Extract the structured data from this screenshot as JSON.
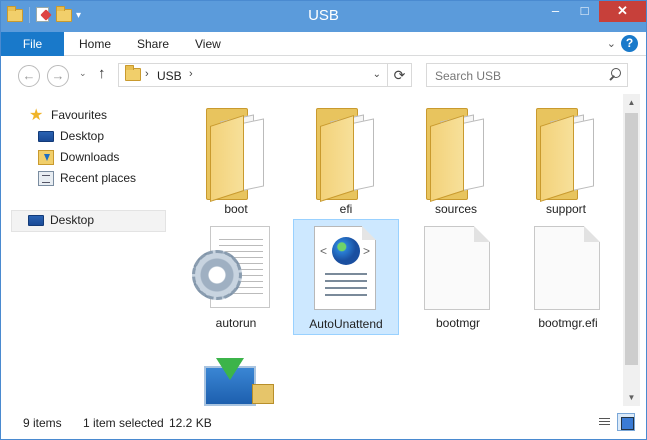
{
  "window": {
    "title": "USB"
  },
  "controls": {
    "minimize": "–",
    "maximize": "□",
    "close": "✕"
  },
  "ribbon": {
    "file_label": "File",
    "tabs": [
      {
        "label": "Home"
      },
      {
        "label": "Share"
      },
      {
        "label": "View"
      }
    ],
    "collapse_glyph": "⌄",
    "help_glyph": "?"
  },
  "nav": {
    "back_glyph": "←",
    "forward_glyph": "→",
    "recent_glyph": "⌄",
    "up_glyph": "↑",
    "address": {
      "segments": [
        "USB"
      ],
      "separator": "›",
      "dropdown_glyph": "⌄",
      "refresh_glyph": "⟳"
    },
    "search": {
      "placeholder": "Search USB"
    }
  },
  "navpane": {
    "favourites_label": "Favourites",
    "favourites": [
      {
        "label": "Desktop",
        "icon": "desktop-icon"
      },
      {
        "label": "Downloads",
        "icon": "downloads-icon"
      },
      {
        "label": "Recent places",
        "icon": "recent-places-icon"
      }
    ],
    "desktop_label": "Desktop"
  },
  "files": [
    {
      "name": "boot",
      "type": "folder"
    },
    {
      "name": "efi",
      "type": "folder"
    },
    {
      "name": "sources",
      "type": "folder"
    },
    {
      "name": "support",
      "type": "folder"
    },
    {
      "name": "autorun",
      "type": "settings-file"
    },
    {
      "name": "AutoUnattend",
      "type": "xml-file",
      "selected": true
    },
    {
      "name": "bootmgr",
      "type": "file"
    },
    {
      "name": "bootmgr.efi",
      "type": "file"
    },
    {
      "name": "",
      "type": "installer"
    }
  ],
  "status": {
    "item_count": "9 items",
    "selection": "1 item selected",
    "size": "12.2 KB"
  },
  "scrollbar": {
    "up_glyph": "▲",
    "down_glyph": "▼"
  },
  "colors": {
    "titlebar": "#5b9bdb",
    "file_tab": "#1979ca",
    "close": "#c7403a",
    "selection": "#cde8ff"
  }
}
